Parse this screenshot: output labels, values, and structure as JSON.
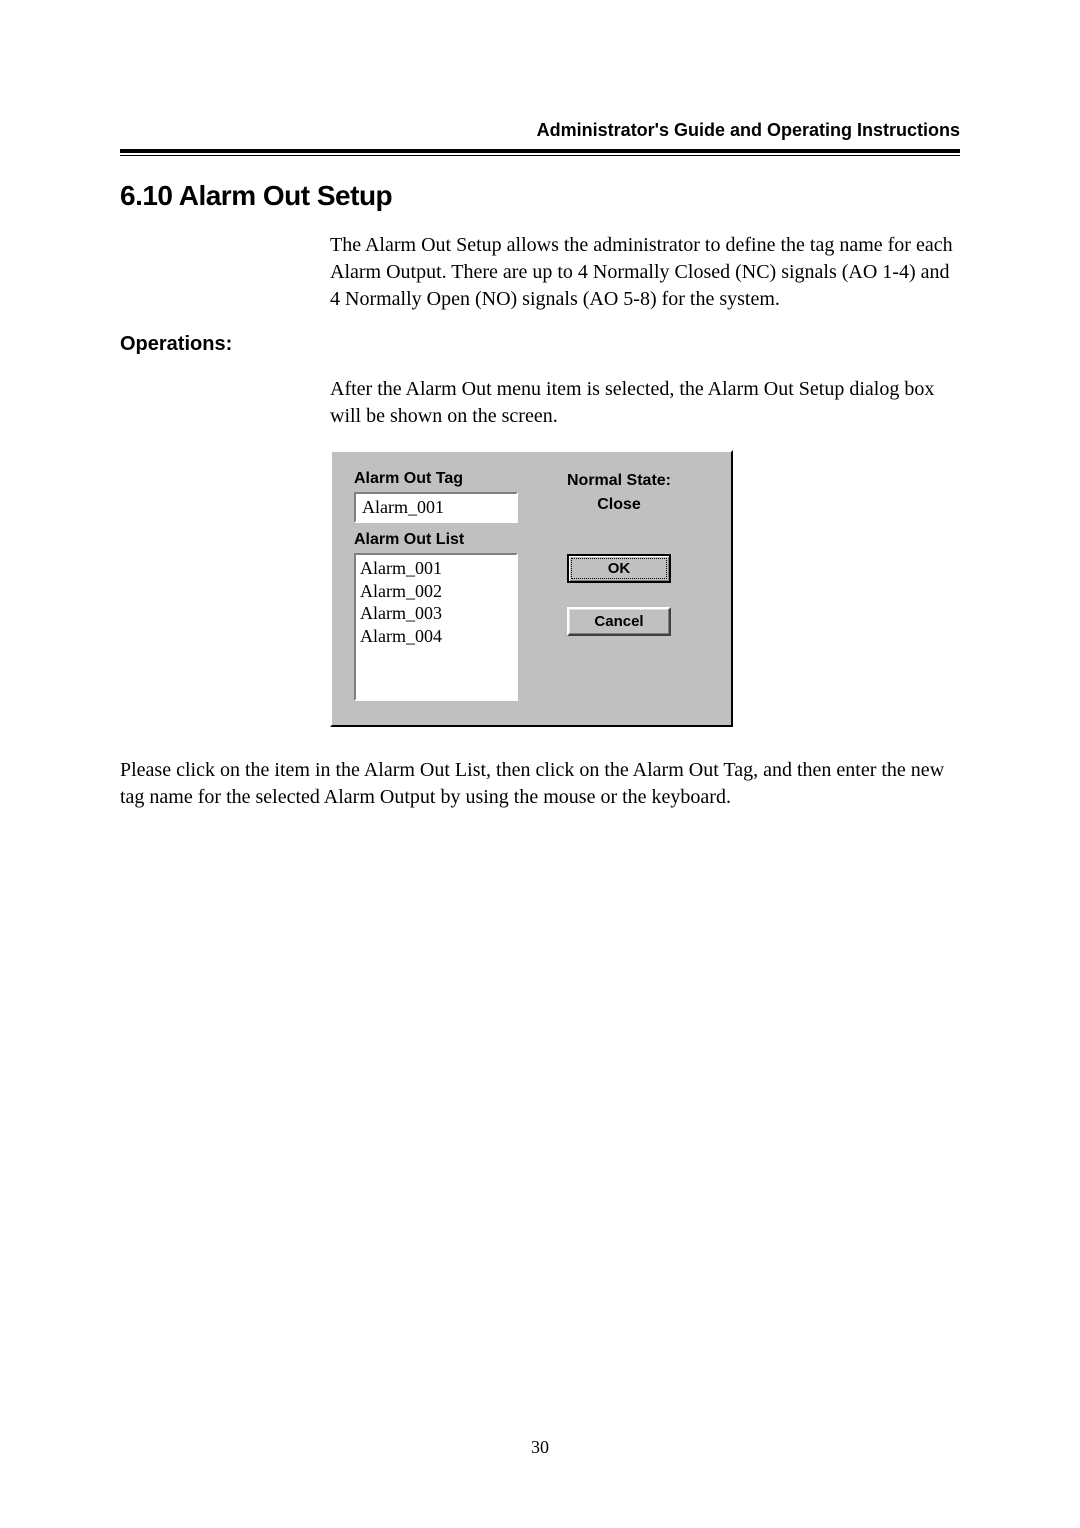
{
  "header": {
    "title": "Administrator's Guide and Operating Instructions"
  },
  "section": {
    "heading": "6.10 Alarm Out Setup",
    "intro": "The Alarm Out Setup allows the administrator to define the tag name for each Alarm Output.    There are up to 4 Normally Closed (NC) signals (AO 1-4) and 4 Normally Open (NO) signals (AO 5-8) for the system.",
    "operations_label": "Operations:",
    "operations_text": "After the Alarm Out menu item is selected, the Alarm Out Setup dialog box will be shown on the screen."
  },
  "dialog": {
    "tag_label": "Alarm Out Tag",
    "tag_value": "Alarm_001",
    "normal_state_label": "Normal State:",
    "normal_state_value": "Close",
    "list_label": "Alarm Out List",
    "list_items": [
      "Alarm_001",
      "Alarm_002",
      "Alarm_003",
      "Alarm_004"
    ],
    "ok_label": "OK",
    "cancel_label": "Cancel"
  },
  "footer_text": "Please click on the item in the Alarm Out List, then click on the Alarm Out Tag, and then enter the new tag name for the selected Alarm Output by using the mouse or the keyboard.",
  "pagenum": "30"
}
